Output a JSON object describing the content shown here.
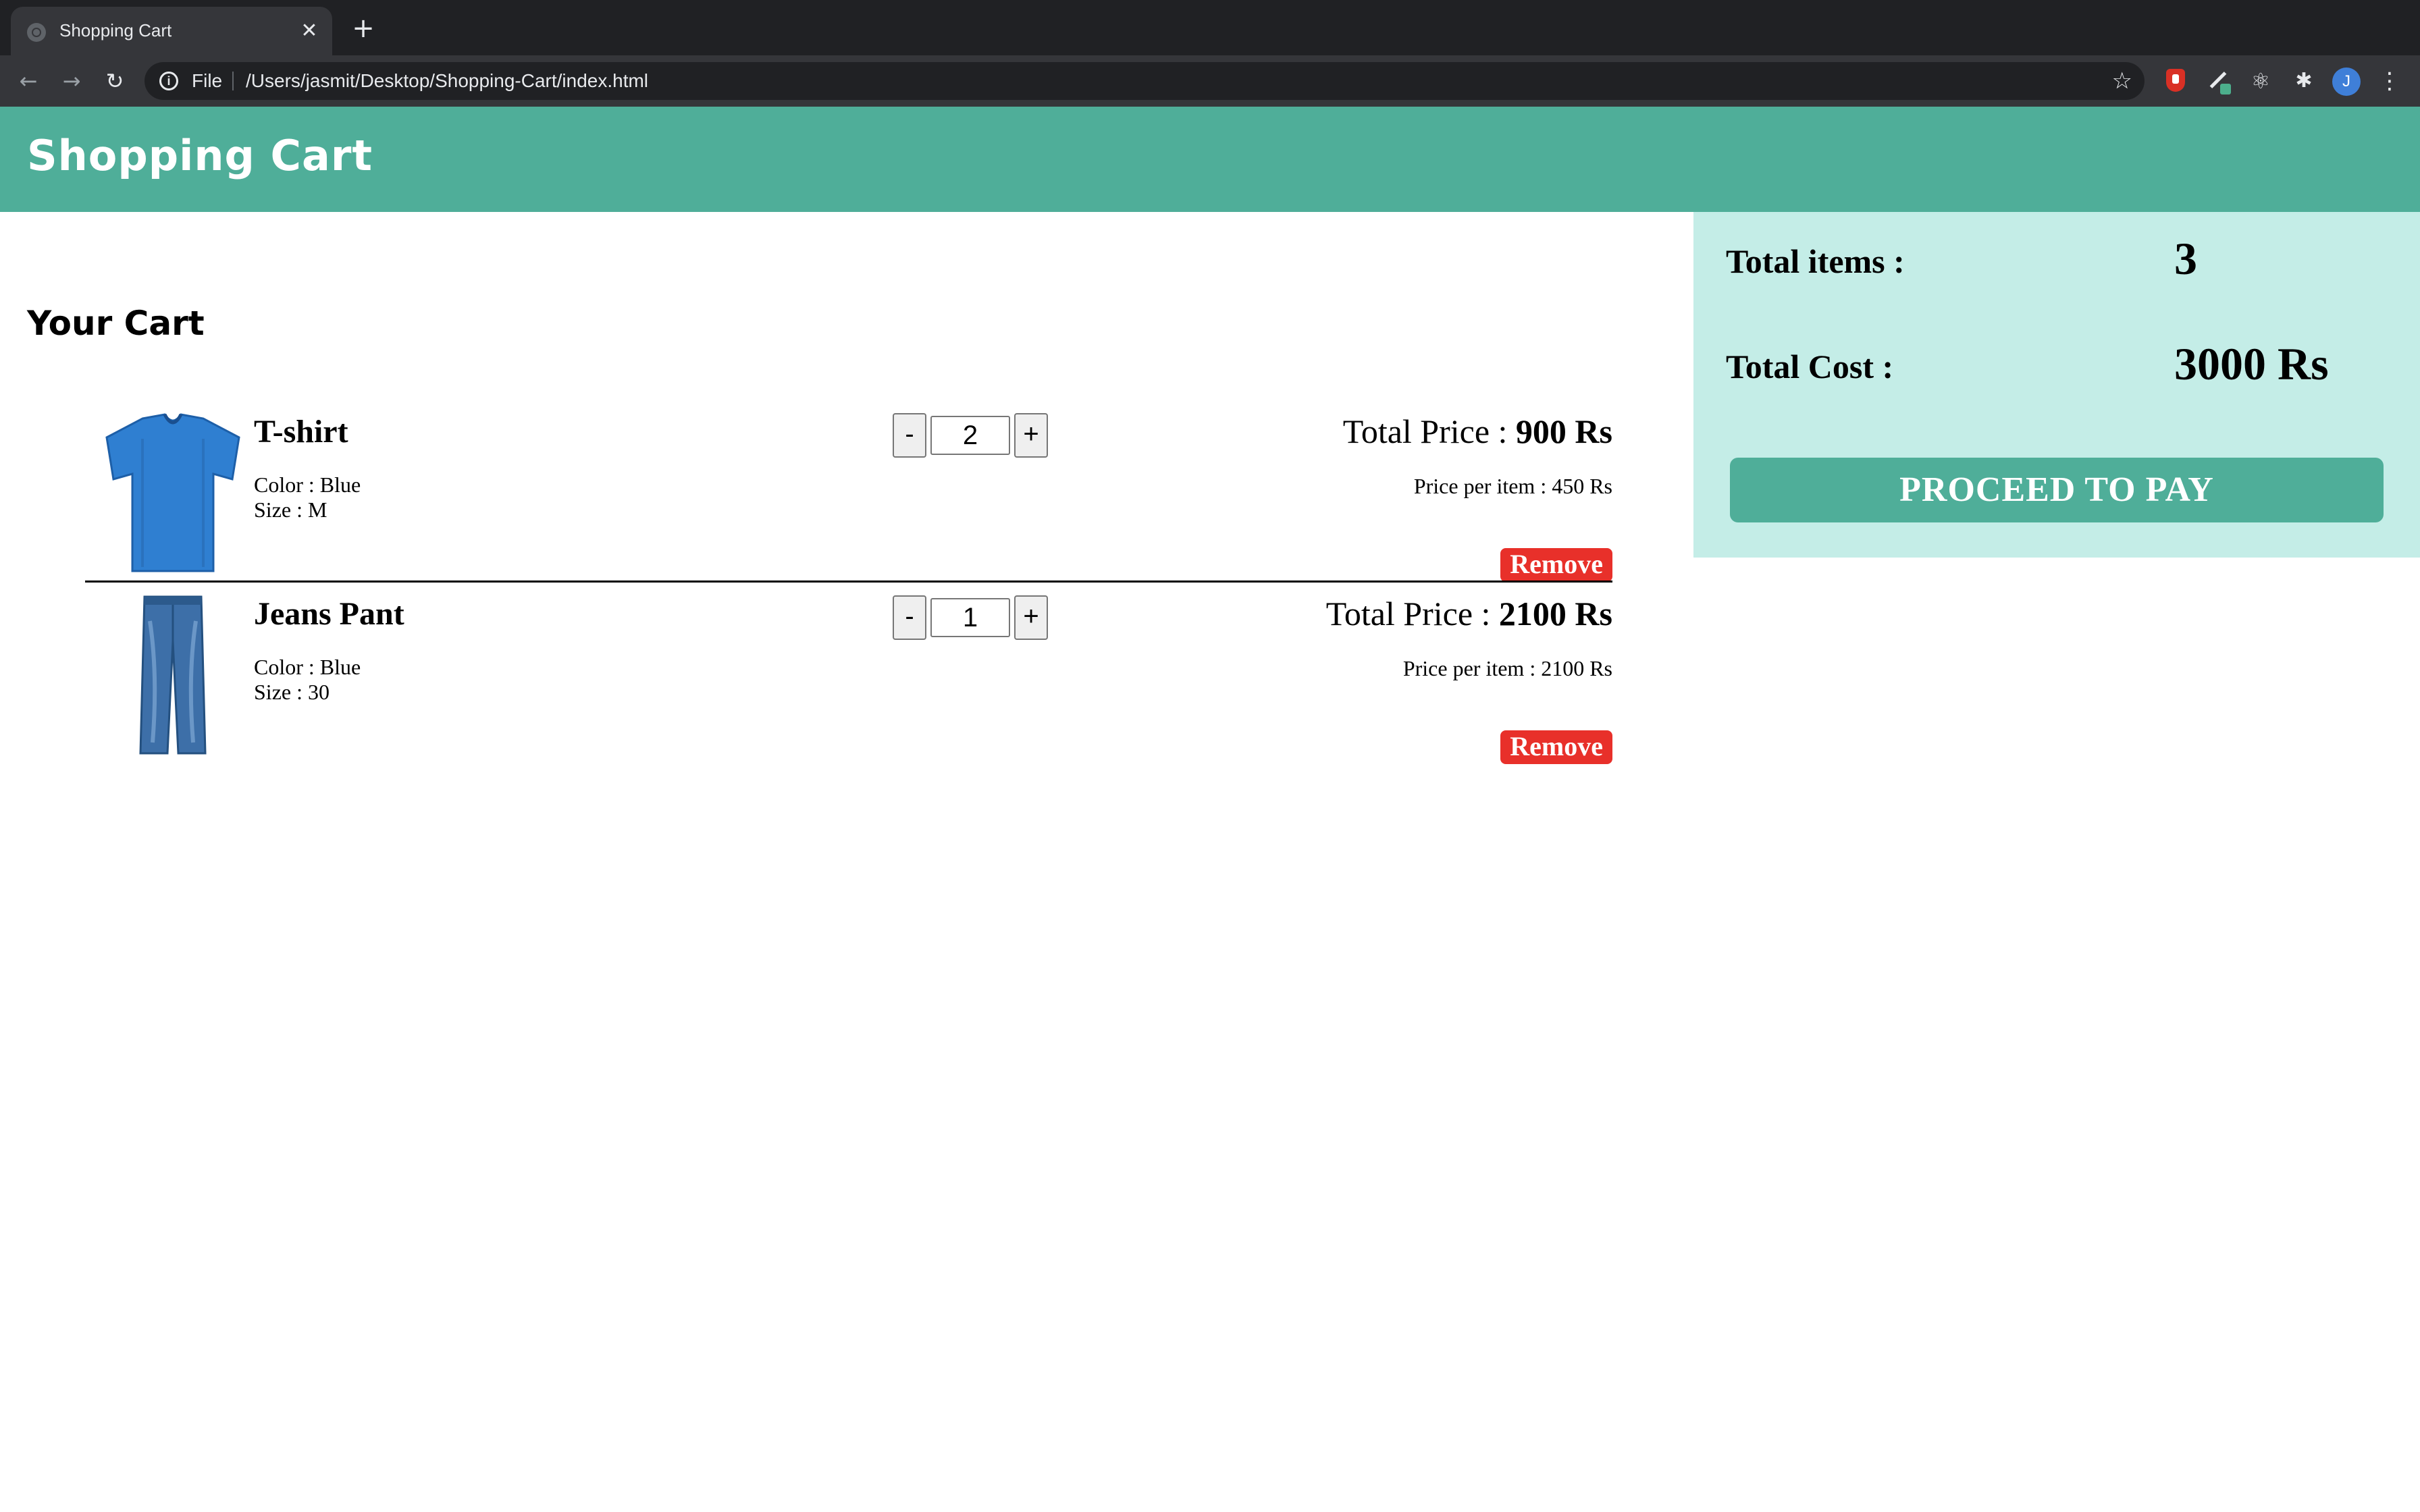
{
  "browser": {
    "tab_title": "Shopping Cart",
    "tab_close": "✕",
    "new_tab": "+",
    "scheme_label": "File",
    "url": "/Users/jasmit/Desktop/Shopping-Cart/index.html",
    "avatar_initial": "J"
  },
  "header": {
    "title": "Shopping Cart",
    "background_color": "#4fae99"
  },
  "cart": {
    "heading": "Your Cart",
    "items": [
      {
        "name": "T-shirt",
        "color_text": "Color : Blue",
        "size_text": "Size : M",
        "quantity": "2",
        "minus_label": "-",
        "plus_label": "+",
        "total_label": "Total Price : ",
        "total_value": "900 Rs",
        "unit_price_text": "Price per item : 450 Rs",
        "remove_label": "Remove",
        "image_icon": "tshirt-image"
      },
      {
        "name": "Jeans Pant",
        "color_text": "Color : Blue",
        "size_text": "Size : 30",
        "quantity": "1",
        "minus_label": "-",
        "plus_label": "+",
        "total_label": "Total Price : ",
        "total_value": "2100 Rs",
        "unit_price_text": "Price per item : 2100 Rs",
        "remove_label": "Remove",
        "image_icon": "jeans-image"
      }
    ]
  },
  "summary": {
    "total_items_label": "Total items :",
    "total_items_value": "3",
    "total_cost_label": "Total Cost :",
    "total_cost_value": "3000 Rs",
    "pay_button_label": "PROCEED TO PAY",
    "background_color": "#c4ede7",
    "remove_color": "#e8302a"
  }
}
